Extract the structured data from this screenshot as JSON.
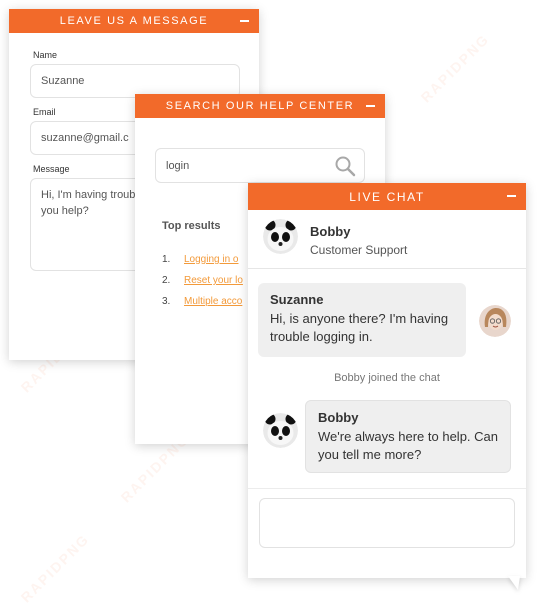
{
  "message_panel": {
    "title": "Leave us a message",
    "name_label": "Name",
    "name_value": "Suzanne",
    "email_label": "Email",
    "email_value": "suzanne@gmail.c",
    "message_label": "Message",
    "message_value": "Hi, I'm having troub Can you help?"
  },
  "help_panel": {
    "title": "Search our help center",
    "search_value": "login",
    "results_heading": "Top results",
    "results": [
      {
        "num": "1.",
        "text": "Logging in o"
      },
      {
        "num": "2.",
        "text": "Reset your lo"
      },
      {
        "num": "3.",
        "text": "Multiple acco"
      }
    ]
  },
  "chat_panel": {
    "title": "Live Chat",
    "agent_name": "Bobby",
    "agent_role": "Customer Support",
    "messages": [
      {
        "sender": "Suzanne",
        "text": "Hi, is anyone there? I'm having trouble logging in."
      },
      {
        "system": "Bobby joined the chat"
      },
      {
        "sender": "Bobby",
        "text": "We're always here to help. Can you tell me more?"
      }
    ],
    "input_value": ""
  },
  "watermark_text": "RAPIDPNG",
  "colors": {
    "accent": "#f26a2a",
    "link": "#f39a3a"
  },
  "icons": [
    "minimize-icon",
    "search-icon",
    "panda-avatar",
    "user-avatar"
  ]
}
